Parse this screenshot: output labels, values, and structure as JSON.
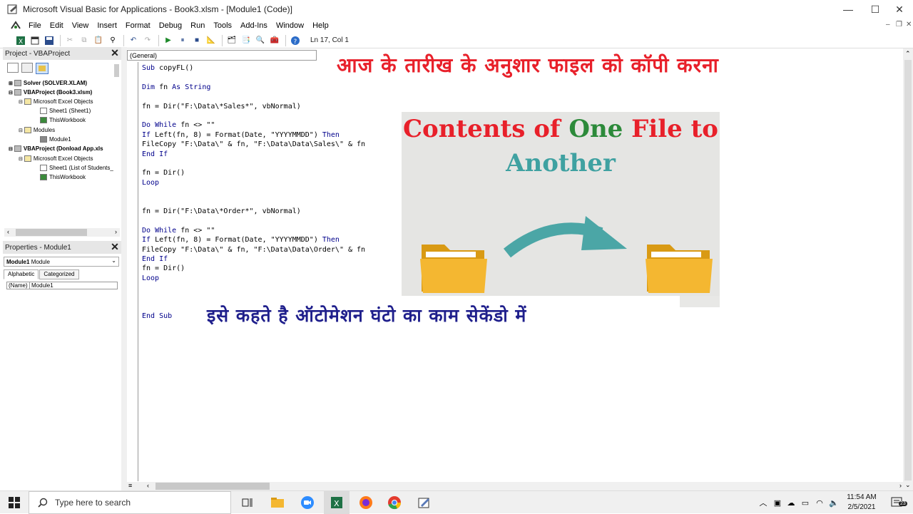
{
  "window": {
    "title": "Microsoft Visual Basic for Applications - Book3.xlsm - [Module1 (Code)]",
    "min": "—",
    "max": "☐",
    "close": "✕"
  },
  "menu": [
    "File",
    "Edit",
    "View",
    "Insert",
    "Format",
    "Debug",
    "Run",
    "Tools",
    "Add-Ins",
    "Window",
    "Help"
  ],
  "mdi_controls": [
    "–",
    "❐",
    "✕"
  ],
  "toolbar": {
    "position": "Ln 17, Col 1"
  },
  "project": {
    "title": "Project - VBAProject",
    "tree": [
      {
        "label": "Solver (SOLVER.XLAM)",
        "bold": true
      },
      {
        "label": "VBAProject (Book3.xlsm)",
        "bold": true
      },
      {
        "label": "Microsoft Excel Objects",
        "bold": false
      },
      {
        "label": "Sheet1 (Sheet1)",
        "bold": false
      },
      {
        "label": "ThisWorkbook",
        "bold": false
      },
      {
        "label": "Modules",
        "bold": false
      },
      {
        "label": "Module1",
        "bold": false
      },
      {
        "label": "VBAProject (Donload App.xls",
        "bold": true
      },
      {
        "label": "Microsoft Excel Objects",
        "bold": false
      },
      {
        "label": "Sheet1 (List of Students_",
        "bold": false
      },
      {
        "label": "ThisWorkbook",
        "bold": false
      }
    ]
  },
  "properties": {
    "title": "Properties - Module1",
    "object_name": "Module1",
    "object_type": "Module",
    "tabs": [
      "Alphabetic",
      "Categorized"
    ],
    "row_key": "(Name)",
    "row_value": "Module1"
  },
  "code": {
    "combo": "(General)",
    "lines": [
      "Sub copyFL()",
      "",
      "Dim fn As String",
      "",
      "fn = Dir(\"F:\\Data\\*Sales*\", vbNormal)",
      "",
      "Do While fn <> \"\"",
      "If Left(fn, 8) = Format(Date, \"YYYYMMDD\") Then",
      "FileCopy \"F:\\Data\\\" & fn, \"F:\\Data\\Data\\Sales\\\" & fn",
      "End If",
      "",
      "fn = Dir()",
      "Loop",
      "",
      "",
      "fn = Dir(\"F:\\Data\\*Order*\", vbNormal)",
      "",
      "Do While fn <> \"\"",
      "If Left(fn, 8) = Format(Date, \"YYYYMMDD\") Then",
      "FileCopy \"F:\\Data\\\" & fn, \"F:\\Data\\Data\\Order\\\" & fn",
      "End If",
      "fn = Dir()",
      "Loop",
      "",
      "",
      "",
      "End Sub"
    ]
  },
  "overlay": {
    "heading_hindi": "आज के तारीख के अनुशार फाइल को कॉपी करना",
    "footer_hindi": "इसे कहते है ऑटोमेशन घंटो का काम सेकेंडो में",
    "banner_line1_a": "Contents of ",
    "banner_line1_b": "One",
    "banner_line1_c": " File to",
    "banner_line2": "Another",
    "colors": {
      "red": "#e8202a",
      "green": "#2c8a3a",
      "teal": "#3fa1a1",
      "navy": "#1f1f8c"
    }
  },
  "taskbar": {
    "search_placeholder": "Type here to search",
    "time": "11:54 AM",
    "date": "2/5/2021",
    "notif": "23"
  }
}
